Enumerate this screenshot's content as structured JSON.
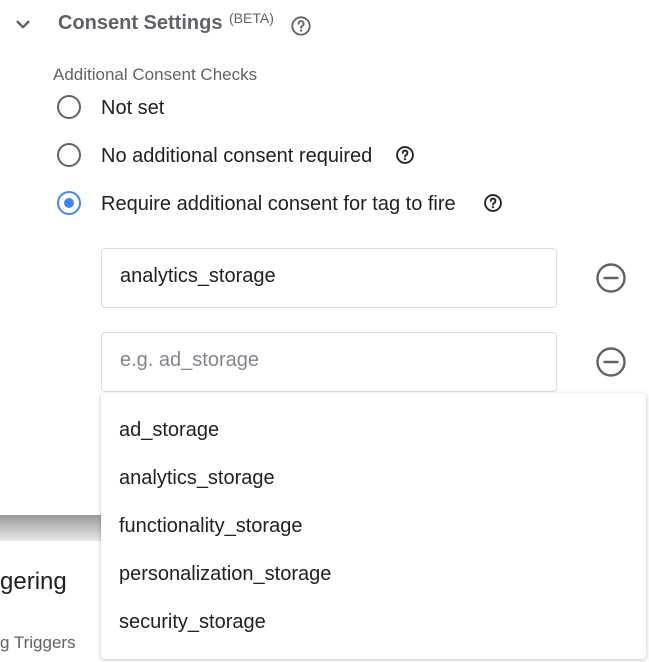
{
  "section": {
    "title": "Consent Settings",
    "beta_badge": "(BETA)"
  },
  "consent_checks": {
    "label": "Additional Consent Checks",
    "options": [
      {
        "label": "Not set",
        "selected": false
      },
      {
        "label": "No additional consent required",
        "selected": false
      },
      {
        "label": "Require additional consent for tag to fire",
        "selected": true
      }
    ]
  },
  "consent_inputs": [
    {
      "value": "analytics_storage",
      "placeholder": ""
    },
    {
      "value": "",
      "placeholder": "e.g. ad_storage"
    }
  ],
  "dropdown": {
    "items": [
      "ad_storage",
      "analytics_storage",
      "functionality_storage",
      "personalization_storage",
      "security_storage"
    ]
  },
  "background": {
    "triggering_title": "gering",
    "triggers_label": "g Triggers"
  },
  "colors": {
    "accent": "#4285f4",
    "muted_text": "#5f6368",
    "text": "#202124",
    "border": "#dadce0"
  },
  "icons": [
    "chevron-down-icon",
    "help-icon",
    "remove-circle-icon"
  ]
}
